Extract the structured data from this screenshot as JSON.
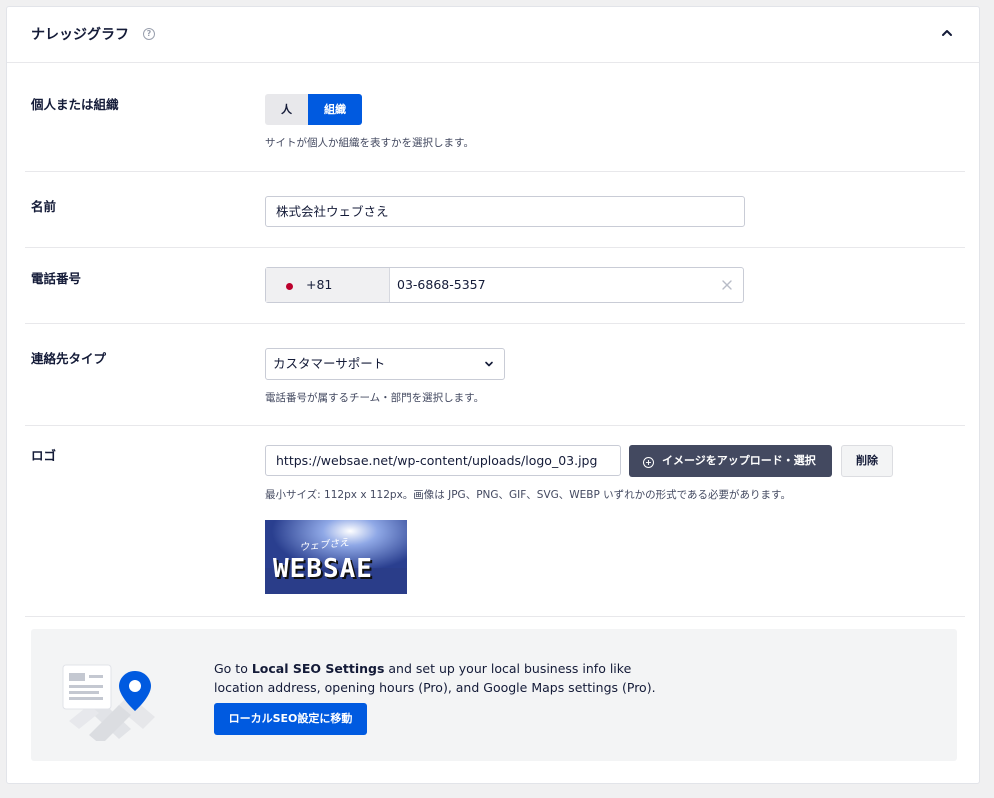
{
  "panel": {
    "title": "ナレッジグラフ",
    "help_glyph": "?"
  },
  "type_row": {
    "label": "個人または組織",
    "options": [
      "人",
      "組織"
    ],
    "selected": "組織",
    "description": "サイトが個人か組織を表すかを選択します。"
  },
  "name_row": {
    "label": "名前",
    "value": "株式会社ウェブさえ"
  },
  "phone_row": {
    "label": "電話番号",
    "country_code": "+81",
    "number": "03-6868-5357"
  },
  "contact_row": {
    "label": "連絡先タイプ",
    "selected": "カスタマーサポート",
    "description": "電話番号が属するチーム・部門を選択します。"
  },
  "logo_row": {
    "label": "ロゴ",
    "url": "https://websae.net/wp-content/uploads/logo_03.jpg",
    "upload_button": "イメージをアップロード・選択",
    "delete_button": "削除",
    "description": "最小サイズ: 112px x 112px。画像は JPG、PNG、GIF、SVG、WEBP いずれかの形式である必要があります。",
    "preview_script_text": "ウェブさえ",
    "preview_brand_text": "WEBSAE"
  },
  "promo": {
    "text_before": "Go to ",
    "text_link": "Local SEO Settings",
    "text_after": " and set up your local business info like location address, opening hours (Pro), and Google Maps settings (Pro).",
    "button": "ローカルSEO設定に移動"
  },
  "colors": {
    "accent": "#005ae0",
    "dark_button": "#434960",
    "text": "#141b38",
    "flag_red": "#bc002d"
  }
}
